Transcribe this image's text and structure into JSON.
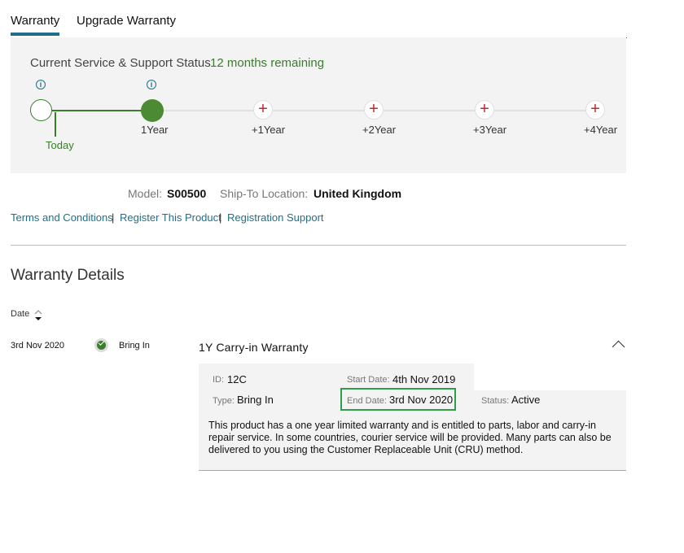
{
  "tabs": [
    {
      "label": "Warranty",
      "active": true
    },
    {
      "label": "Upgrade Warranty",
      "active": false
    }
  ],
  "status": {
    "label": "Current Service & Support Status",
    "remaining": "12 months remaining"
  },
  "timeline": {
    "today_label": "Today",
    "points": [
      "1Year",
      "+1Year",
      "+2Year",
      "+3Year",
      "+4Year"
    ]
  },
  "product": {
    "model_label": "Model:",
    "model_value": "S00500",
    "ship_label": "Ship-To Location:",
    "ship_value": "United Kingdom"
  },
  "links": {
    "terms": "Terms and Conditions",
    "register": "Register This Product",
    "support": "Registration Support",
    "separator": "|"
  },
  "details": {
    "heading": "Warranty Details",
    "sort_label": "Date",
    "row": {
      "date": "3rd Nov 2020",
      "service": "Bring In",
      "title": "1Y Carry-in Warranty",
      "id_label": "ID:",
      "id_value": "12C",
      "start_label": "Start Date:",
      "start_value": "4th Nov 2019",
      "type_label": "Type:",
      "type_value": "Bring In",
      "end_label": "End Date:",
      "end_value": "3rd Nov 2020",
      "status_label": "Status:",
      "status_value": "Active",
      "description": "This product has a one year limited warranty and is entitled to parts, labor and carry-in repair service. In some countries, courier service will be provided. Many parts can also be delivered to you using the Customer Replaceable Unit (CRU) method."
    }
  },
  "colors": {
    "green": "#3a7d2c",
    "link": "#1f6f8b",
    "plus": "#c0282d",
    "highlight": "#2f9e4a"
  },
  "icons": [
    "info-icon",
    "plus-icon",
    "sort-icon",
    "check-circle-icon",
    "chevron-up-icon"
  ]
}
